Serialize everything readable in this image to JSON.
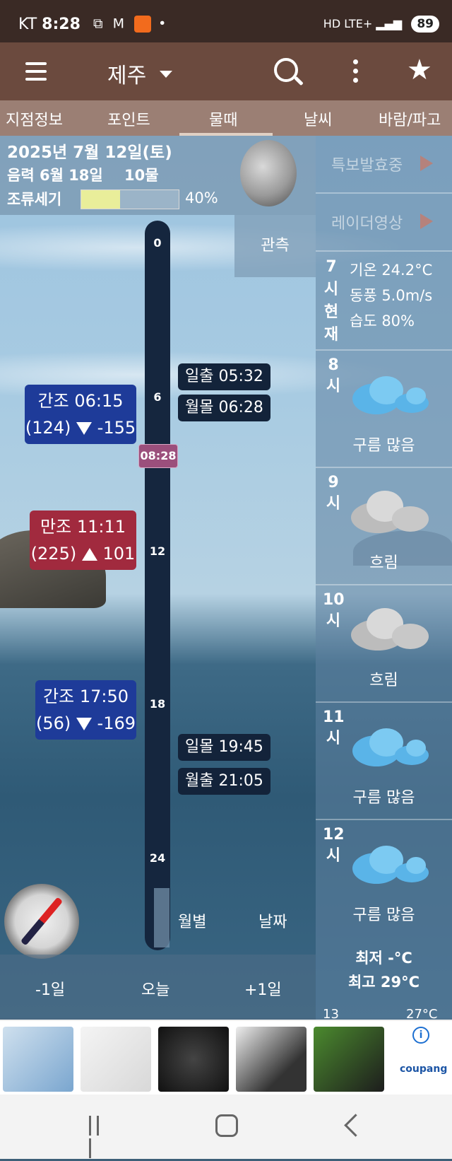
{
  "status_bar": {
    "carrier": "KT",
    "time": "8:28",
    "network": "HD LTE+",
    "battery": "89"
  },
  "app_bar": {
    "location": "제주"
  },
  "tabs": [
    "지점정보",
    "포인트",
    "물때",
    "날씨",
    "바람/파고"
  ],
  "info": {
    "date": "2025년 7월 12일(토)",
    "lunar": "음력 6월 18일",
    "mul": "10물",
    "flow_label": "조류세기",
    "flow_percent_text": "40%",
    "flow_fraction": 0.4
  },
  "right_panel": {
    "warning_label": "특보발효중",
    "radar_label": "레이더영상",
    "current": {
      "hour_chars": [
        "7",
        "시",
        "현",
        "재"
      ],
      "temp": "기온 24.2°C",
      "wind": "동풍 5.0m/s",
      "humidity": "습도 80%"
    },
    "hours": [
      {
        "h1": "8",
        "h2": "시",
        "desc": "구름 많음",
        "icon": "partly-cloudy-icon"
      },
      {
        "h1": "9",
        "h2": "시",
        "desc": "흐림",
        "icon": "overcast-icon"
      },
      {
        "h1": "10",
        "h2": "시",
        "desc": "흐림",
        "icon": "overcast-icon"
      },
      {
        "h1": "11",
        "h2": "시",
        "desc": "구름 많음",
        "icon": "partly-cloudy-icon"
      },
      {
        "h1": "12",
        "h2": "시",
        "desc": "구름 많음",
        "icon": "partly-cloudy-icon"
      }
    ],
    "min_temp": "최저 -°C",
    "max_temp": "최고 29°C",
    "next_hour": "13",
    "next_temp": "27°C"
  },
  "observation_label": "관측",
  "timeline": {
    "ticks": [
      "0",
      "6",
      "12",
      "18",
      "24"
    ],
    "now": "08:28"
  },
  "sun_moon": {
    "sunrise": "일출 05:32",
    "moonset": "월몰 06:28",
    "sunset": "일몰 19:45",
    "moonrise": "월출 21:05"
  },
  "tides": [
    {
      "type": "간조",
      "time": "06:15",
      "level": "(124)",
      "diff": "-155"
    },
    {
      "type": "만조",
      "time": "11:11",
      "level": "(225)",
      "diff": "101"
    },
    {
      "type": "간조",
      "time": "17:50",
      "level": "(56)",
      "diff": "-169"
    }
  ],
  "view_buttons": {
    "monthly": "월별",
    "date": "날짜"
  },
  "day_nav": {
    "prev": "-1일",
    "today": "오늘",
    "next": "+1일"
  },
  "ad": {
    "brand": "coupang",
    "info": "i"
  },
  "colors": {
    "status_bar": "#3a2a25",
    "app_bar": "#6b4a3e",
    "tab_bar": "#9b7f74",
    "low_tide": "#1e3b99",
    "high_tide": "#a12a3e",
    "now_badge": "#9b4f7c",
    "timeline": "#15263e",
    "flow_fill": "#e9ee9a"
  }
}
